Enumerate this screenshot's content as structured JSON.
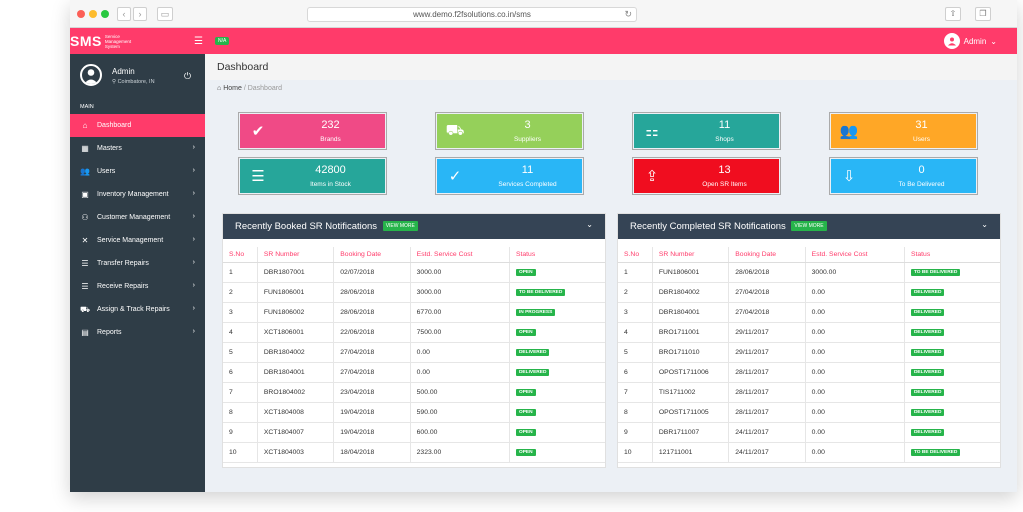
{
  "browser": {
    "url": "www.demo.f2fsolutions.co.in/sms"
  },
  "app": {
    "logo_big": "SMS",
    "logo_small": "Service Management System",
    "na_badge": "N/A",
    "admin_label": "Admin"
  },
  "sidebar": {
    "user_name": "Admin",
    "user_location": "Coimbatore, IN",
    "section": "MAIN",
    "items": [
      {
        "label": "Dashboard",
        "icon": "home-icon"
      },
      {
        "label": "Masters",
        "icon": "grid-icon"
      },
      {
        "label": "Users",
        "icon": "users-icon"
      },
      {
        "label": "Inventory Management",
        "icon": "briefcase-icon"
      },
      {
        "label": "Customer Management",
        "icon": "network-icon"
      },
      {
        "label": "Service Management",
        "icon": "tools-icon"
      },
      {
        "label": "Transfer Repairs",
        "icon": "sliders-icon"
      },
      {
        "label": "Receive Repairs",
        "icon": "sliders-icon"
      },
      {
        "label": "Assign & Track Repairs",
        "icon": "truck-icon"
      },
      {
        "label": "Reports",
        "icon": "report-icon"
      }
    ]
  },
  "header": {
    "title": "Dashboard"
  },
  "breadcrumb": {
    "home": "Home",
    "current": "Dashboard"
  },
  "tiles": [
    {
      "value": "232",
      "label": "Brands",
      "color": "#f04a86",
      "icon": "check-circle-icon"
    },
    {
      "value": "3",
      "label": "Suppliers",
      "color": "#95d05a",
      "icon": "truck-icon"
    },
    {
      "value": "11",
      "label": "Shops",
      "color": "#26a69a",
      "icon": "sitemap-icon"
    },
    {
      "value": "31",
      "label": "Users",
      "color": "#ffa726",
      "icon": "users-icon"
    },
    {
      "value": "42800",
      "label": "Items in Stock",
      "color": "#26a69a",
      "icon": "database-icon"
    },
    {
      "value": "11",
      "label": "Services Completed",
      "color": "#29b6f6",
      "icon": "clipboard-check-icon"
    },
    {
      "value": "13",
      "label": "Open SR Items",
      "color": "#f00d1f",
      "icon": "inbox-out-icon"
    },
    {
      "value": "0",
      "label": "To Be Delivered",
      "color": "#29b6f6",
      "icon": "inbox-in-icon"
    }
  ],
  "panels": {
    "view_more": "VIEW MORE",
    "booked": {
      "title": "Recently Booked SR Notifications",
      "headers": [
        "S.No",
        "SR Number",
        "Booking Date",
        "Estd. Service Cost",
        "Status"
      ],
      "rows": [
        [
          "1",
          "DBR1807001",
          "02/07/2018",
          "3000.00",
          "OPEN"
        ],
        [
          "2",
          "FUN1806001",
          "28/06/2018",
          "3000.00",
          "TO BE DELIVERED"
        ],
        [
          "3",
          "FUN1806002",
          "28/06/2018",
          "6770.00",
          "IN PROGRESS"
        ],
        [
          "4",
          "XCT1806001",
          "22/06/2018",
          "7500.00",
          "OPEN"
        ],
        [
          "5",
          "DBR1804002",
          "27/04/2018",
          "0.00",
          "DELIVERED"
        ],
        [
          "6",
          "DBR1804001",
          "27/04/2018",
          "0.00",
          "DELIVERED"
        ],
        [
          "7",
          "BRO1804002",
          "23/04/2018",
          "500.00",
          "OPEN"
        ],
        [
          "8",
          "XCT1804008",
          "19/04/2018",
          "590.00",
          "OPEN"
        ],
        [
          "9",
          "XCT1804007",
          "19/04/2018",
          "600.00",
          "OPEN"
        ],
        [
          "10",
          "XCT1804003",
          "18/04/2018",
          "2323.00",
          "OPEN"
        ]
      ]
    },
    "completed": {
      "title": "Recently Completed SR Notifications",
      "headers": [
        "S.No",
        "SR Number",
        "Booking Date",
        "Estd. Service Cost",
        "Status"
      ],
      "rows": [
        [
          "1",
          "FUN1806001",
          "28/06/2018",
          "3000.00",
          "TO BE DELIVERED"
        ],
        [
          "2",
          "DBR1804002",
          "27/04/2018",
          "0.00",
          "DELIVERED"
        ],
        [
          "3",
          "DBR1804001",
          "27/04/2018",
          "0.00",
          "DELIVERED"
        ],
        [
          "4",
          "BRO1711001",
          "29/11/2017",
          "0.00",
          "DELIVERED"
        ],
        [
          "5",
          "BRO1711010",
          "29/11/2017",
          "0.00",
          "DELIVERED"
        ],
        [
          "6",
          "OPOST1711006",
          "28/11/2017",
          "0.00",
          "DELIVERED"
        ],
        [
          "7",
          "TIS1711002",
          "28/11/2017",
          "0.00",
          "DELIVERED"
        ],
        [
          "8",
          "OPOST1711005",
          "28/11/2017",
          "0.00",
          "DELIVERED"
        ],
        [
          "9",
          "DBR1711007",
          "24/11/2017",
          "0.00",
          "DELIVERED"
        ],
        [
          "10",
          "121711001",
          "24/11/2017",
          "0.00",
          "TO BE DELIVERED"
        ]
      ]
    }
  }
}
